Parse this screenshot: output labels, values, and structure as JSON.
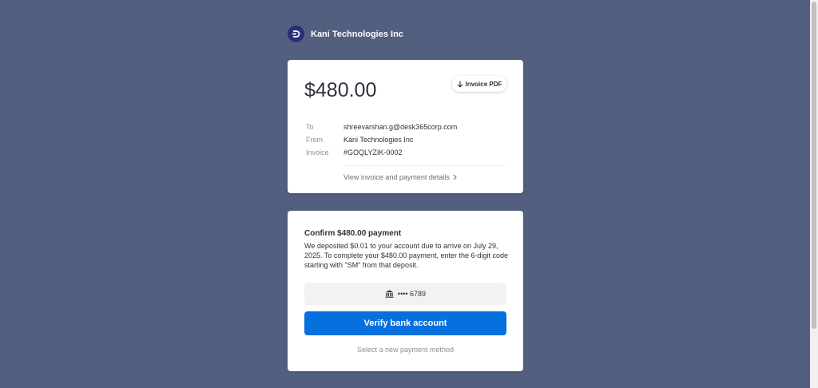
{
  "header": {
    "company_name": "Kani Technologies Inc",
    "logo_icon": "d-logo-icon"
  },
  "invoice": {
    "amount": "$480.00",
    "pdf_button_label": "Invoice PDF",
    "details": [
      {
        "label": "To",
        "value": "shreevarshan.g@desk365corp.com"
      },
      {
        "label": "From",
        "value": "Kani Technologies Inc"
      },
      {
        "label": "Invoice",
        "value": "#GOQLYZIK-0002"
      }
    ],
    "view_details_link": "View invoice and payment details"
  },
  "confirm": {
    "title": "Confirm $480.00 payment",
    "body": "We deposited $0.01 to your account due to arrive on July 29, 2025. To complete your $480.00 payment, enter the 6-digit code starting with \"SM\" from that deposit.",
    "account_masked": "•••• 6789",
    "verify_button_label": "Verify bank account",
    "new_method_link": "Select a new payment method"
  },
  "colors": {
    "background": "#525f7f",
    "primary_button": "#0570de",
    "logo": "#2a2f7a"
  }
}
